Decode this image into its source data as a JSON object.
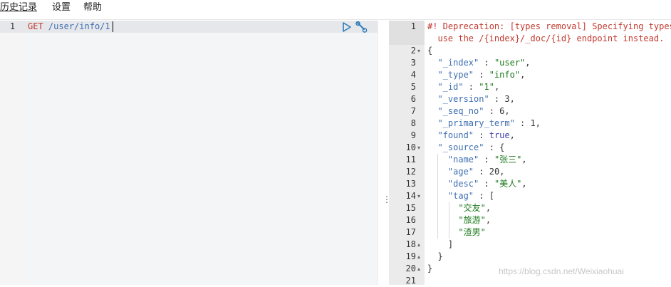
{
  "menu": {
    "history": "历史记录",
    "settings": "设置",
    "help": "帮助"
  },
  "request": {
    "line_number": "1",
    "method": "GET",
    "url": "/user/info/1"
  },
  "icons": {
    "run": "play-icon",
    "settings": "wrench-icon",
    "resize": "vertical-dots-icon"
  },
  "response": {
    "line_numbers": [
      "1",
      "",
      "2",
      "3",
      "4",
      "5",
      "6",
      "7",
      "8",
      "9",
      "10",
      "11",
      "12",
      "13",
      "14",
      "15",
      "16",
      "17",
      "18",
      "19",
      "20",
      "21"
    ],
    "warning_line1": "#! Deprecation: [types removal] Specifying types in",
    "warning_line2": "  use the /{index}/_doc/{id} endpoint instead.",
    "lines": [
      {
        "n": "2",
        "parts": [
          [
            "p",
            "{"
          ]
        ]
      },
      {
        "n": "3",
        "parts": [
          [
            "p",
            "  "
          ],
          [
            "key",
            "\"_index\""
          ],
          [
            "p",
            " : "
          ],
          [
            "str",
            "\"user\""
          ],
          [
            "p",
            ","
          ]
        ]
      },
      {
        "n": "4",
        "parts": [
          [
            "p",
            "  "
          ],
          [
            "key",
            "\"_type\""
          ],
          [
            "p",
            " : "
          ],
          [
            "str",
            "\"info\""
          ],
          [
            "p",
            ","
          ]
        ]
      },
      {
        "n": "5",
        "parts": [
          [
            "p",
            "  "
          ],
          [
            "key",
            "\"_id\""
          ],
          [
            "p",
            " : "
          ],
          [
            "str",
            "\"1\""
          ],
          [
            "p",
            ","
          ]
        ]
      },
      {
        "n": "6",
        "parts": [
          [
            "p",
            "  "
          ],
          [
            "key",
            "\"_version\""
          ],
          [
            "p",
            " : "
          ],
          [
            "num",
            "3"
          ],
          [
            "p",
            ","
          ]
        ]
      },
      {
        "n": "7",
        "parts": [
          [
            "p",
            "  "
          ],
          [
            "key",
            "\"_seq_no\""
          ],
          [
            "p",
            " : "
          ],
          [
            "num",
            "6"
          ],
          [
            "p",
            ","
          ]
        ]
      },
      {
        "n": "8",
        "parts": [
          [
            "p",
            "  "
          ],
          [
            "key",
            "\"_primary_term\""
          ],
          [
            "p",
            " : "
          ],
          [
            "num",
            "1"
          ],
          [
            "p",
            ","
          ]
        ]
      },
      {
        "n": "9",
        "parts": [
          [
            "p",
            "  "
          ],
          [
            "key",
            "\"found\""
          ],
          [
            "p",
            " : "
          ],
          [
            "bool",
            "true"
          ],
          [
            "p",
            ","
          ]
        ]
      },
      {
        "n": "10",
        "parts": [
          [
            "p",
            "  "
          ],
          [
            "key",
            "\"_source\""
          ],
          [
            "p",
            " : {"
          ]
        ]
      },
      {
        "n": "11",
        "parts": [
          [
            "p",
            "    "
          ],
          [
            "key",
            "\"name\""
          ],
          [
            "p",
            " : "
          ],
          [
            "str",
            "\"张三\""
          ],
          [
            "p",
            ","
          ]
        ]
      },
      {
        "n": "12",
        "parts": [
          [
            "p",
            "    "
          ],
          [
            "key",
            "\"age\""
          ],
          [
            "p",
            " : "
          ],
          [
            "num",
            "20"
          ],
          [
            "p",
            ","
          ]
        ]
      },
      {
        "n": "13",
        "parts": [
          [
            "p",
            "    "
          ],
          [
            "key",
            "\"desc\""
          ],
          [
            "p",
            " : "
          ],
          [
            "str",
            "\"美人\""
          ],
          [
            "p",
            ","
          ]
        ]
      },
      {
        "n": "14",
        "parts": [
          [
            "p",
            "    "
          ],
          [
            "key",
            "\"tag\""
          ],
          [
            "p",
            " : ["
          ]
        ]
      },
      {
        "n": "15",
        "parts": [
          [
            "p",
            "      "
          ],
          [
            "str",
            "\"交友\""
          ],
          [
            "p",
            ","
          ]
        ]
      },
      {
        "n": "16",
        "parts": [
          [
            "p",
            "      "
          ],
          [
            "str",
            "\"旅游\""
          ],
          [
            "p",
            ","
          ]
        ]
      },
      {
        "n": "17",
        "parts": [
          [
            "p",
            "      "
          ],
          [
            "str",
            "\"渣男\""
          ]
        ]
      },
      {
        "n": "18",
        "parts": [
          [
            "p",
            "    ]"
          ]
        ]
      },
      {
        "n": "19",
        "parts": [
          [
            "p",
            "  }"
          ]
        ]
      },
      {
        "n": "20",
        "parts": [
          [
            "p",
            "}"
          ]
        ]
      },
      {
        "n": "21",
        "parts": [
          [
            "p",
            ""
          ]
        ]
      }
    ],
    "fold_markers": {
      "2": "▾",
      "10": "▾",
      "14": "▾",
      "18": "▴",
      "19": "▴",
      "20": "▴"
    }
  },
  "watermark": "https://blog.csdn.net/Weixiaohuai",
  "colors": {
    "method": "#c23a2f",
    "key": "#3f6fb1",
    "string": "#1a7a1a",
    "warning": "#c23a2f",
    "icon": "#2b7bb9"
  }
}
